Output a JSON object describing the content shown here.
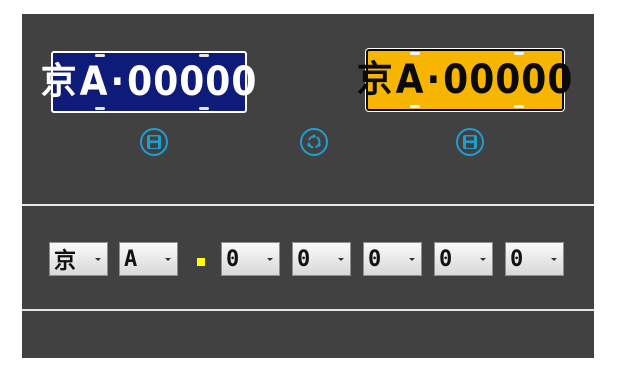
{
  "plates": {
    "blue": {
      "province": "京",
      "letter": "A",
      "dot": "·",
      "number": "00000",
      "color": "#0f1b78"
    },
    "yellow": {
      "province": "京",
      "letter": "A",
      "dot": "·",
      "number": "00000",
      "color": "#f7b500"
    }
  },
  "icons": {
    "save_left": "save-icon",
    "refresh": "refresh-icon",
    "save_right": "save-icon",
    "accent_color": "#1e9fd0"
  },
  "selectors": [
    {
      "value": "京"
    },
    {
      "value": "A"
    },
    {
      "value": "0"
    },
    {
      "value": "0"
    },
    {
      "value": "0"
    },
    {
      "value": "0"
    },
    {
      "value": "0"
    }
  ],
  "separator_color": "#ffff00"
}
